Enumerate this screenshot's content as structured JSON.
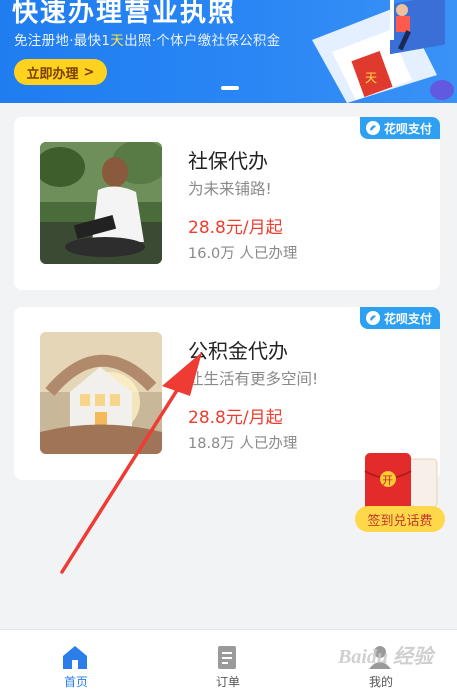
{
  "banner": {
    "title": "快速办理营业执照",
    "subtitle_pre": "免注册地·最快1",
    "subtitle_highlight": "天",
    "subtitle_post": "出照·个体户缴社保公积金",
    "cta_label": "立即办理",
    "cta_arrow": ">",
    "art_day_label": "天"
  },
  "cards": [
    {
      "badge": "花呗支付",
      "title": "社保代办",
      "desc": "为未来铺路!",
      "price": "28.8元/月起",
      "count": "16.0万 人已办理"
    },
    {
      "badge": "花呗支付",
      "title": "公积金代办",
      "desc": "让生活有更多空间!",
      "price": "28.8元/月起",
      "count": "18.8万 人已办理"
    }
  ],
  "promo": {
    "packet_char": "开",
    "label": "签到兑话费"
  },
  "tabbar": {
    "items": [
      {
        "label": "首页",
        "icon": "home-icon",
        "active": true
      },
      {
        "label": "订单",
        "icon": "order-icon",
        "active": false
      },
      {
        "label": "我的",
        "icon": "profile-icon",
        "active": false
      }
    ]
  },
  "watermark": "Baidu 经验",
  "colors": {
    "brand_blue": "#2b7de9",
    "price_red": "#f03c2e",
    "badge_blue": "#2ea0f2",
    "cta_yellow": "#ffd21f",
    "annotation_red": "#ee3b34"
  }
}
